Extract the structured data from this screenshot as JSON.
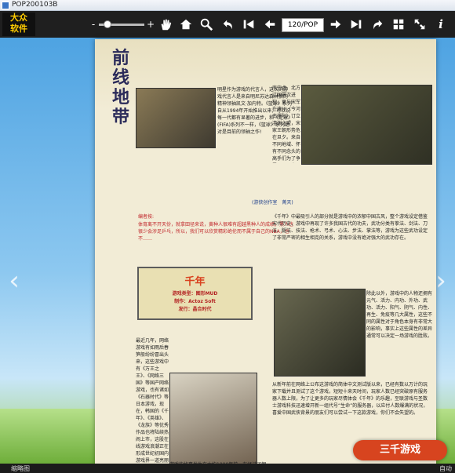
{
  "window": {
    "title": "POP200103B"
  },
  "logo": {
    "line1": "大众",
    "line2": "软件"
  },
  "toolbar": {
    "zoom_minus": "-",
    "zoom_plus": "+",
    "page_indicator": "120/POP",
    "icons": [
      "hand-icon",
      "home-icon",
      "zoom-icon",
      "back-icon",
      "first-page-icon",
      "prev-page-icon",
      "next-page-icon",
      "last-page-icon",
      "rotate-icon",
      "grid-icon",
      "fullscreen-icon",
      "info-icon"
    ]
  },
  "magazine": {
    "section_title": "前线地带",
    "intro_text": "明星作为游戏的代言人，这次的游戏代言人是来自明尼苏达森林狼的精神领袖凯文·加内特。《篮球》系列自从1994年开始推出以来，可以说每一代都有显著的进步，和《足球》(FIFA)系列不一样，《篮球》系列绝对是目前的领袖之作!",
    "author": "(游侠创作室　菁天)",
    "editor_note_label": "编者按:",
    "editor_note": "体育离不开天份，就拿田径来说，黄种人很难有超越黑种人的成绩，黑人也很少会涉足乒乓，所以，我们可以欣赏精彩绝伦而不属于自己的NBA，也不……",
    "game": {
      "name": "千年",
      "genre": "游戏类型：图形MUD",
      "developer": "制作：Actoz Soft",
      "publisher": "发行：晶合时代"
    },
    "col_left_body": "最近几年，网络游戏有如雨后春笋般纷纷冒出头来，这些游戏中有《万王之王》、《网络三国》等国产网络游戏，也有诸如《石器时代》等日本游戏，现在，韩国的《千年》、《英雄》、《龙族》等优秀作品也将陆续热闹上市，这股在线游戏浪潮正在形成世纪初国内游戏界一道亮丽的风景线。",
    "col_left_tail": "游戏的故事发生在大约1000年前，在经过了朝",
    "col_right_top": "库空虚，北方辽国屡次进犯，更与宋军在澶州（今河南濮阳）订立澶渊之盟，宋家王朝形势危在旦夕。来自不同地域、怀有不同念头的高手们为了争霸天下而齐至。阴谋与宝藏、生存与争斗，在这样的世界里，我们在其中是一个游侠的侠客修练功夫，谁是到南北朝代去的各路英雄，都将被卷进这场争斗的时代风云。",
    "col_right_mid": "《千年》中最吸引人的部分就是游戏中的浓郁中国古风，整个游戏设定借鉴宋代历史，游戏中再现了许多我国古代的功夫，武功分类有拳法、剑法、刀法、腿法、技法、枪术、弓术、心法、步法、掌法等，游戏为这些武功设定了非常严密的相生相克的关系，游戏中没有绝对强大的武功存在。",
    "col_right_attr": "除此以外，游戏中的人物还拥有元气、活力、内功、外功、武功、活力、阳气、阴气、内性、再生、免疫等几大属性，这些不同的属性对于角色本身有非常大的影响，事实上这些属性的差异通常可以决定一场游戏的胜败。",
    "col_right_bottom": "从新年前在网络上公布这游戏的简体中文测试版以来，已经有数以万计的玩家下载并且测试了这个游戏，短短十来天时间，玩家人数已经突破原有服务器人数上限，为了让更多的玩家尽情体会《千年》的乐趣，至联游戏与圣数士游戏科技迅速增开新一组代号“生命”的服务器，以应付人数爆满的状况，喜爱中国武侠背景的朋友们可以尝试一下这款游戏，你们不会失望的。"
  },
  "status": {
    "left": "缩略图",
    "right": "自动"
  },
  "badge": {
    "text": "三千游戏"
  },
  "colors": {
    "toolbar": "#1f1f1f",
    "accent": "#d7441f",
    "page": "#f2ecd6"
  }
}
